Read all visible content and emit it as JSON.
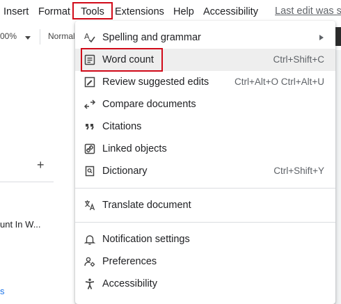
{
  "menubar": {
    "items": [
      "Insert",
      "Format",
      "Tools",
      "Extensions",
      "Help",
      "Accessibility"
    ],
    "last_edit": "Last edit was se"
  },
  "toolbar": {
    "zoom": "00%",
    "style": "Normal"
  },
  "left_panel": {
    "add_symbol": "+",
    "outline_item": "unt In W...",
    "outline_item_2": "s"
  },
  "tools_menu": {
    "items": [
      {
        "label": "Spelling and grammar",
        "icon": "spelling-check-icon",
        "submenu": true
      },
      {
        "label": "Word count",
        "icon": "word-count-icon",
        "shortcut": "Ctrl+Shift+C"
      },
      {
        "label": "Review suggested edits",
        "icon": "review-edits-icon",
        "shortcut": "Ctrl+Alt+O Ctrl+Alt+U"
      },
      {
        "label": "Compare documents",
        "icon": "compare-icon"
      },
      {
        "label": "Citations",
        "icon": "quote-icon"
      },
      {
        "label": "Linked objects",
        "icon": "link-icon"
      },
      {
        "label": "Dictionary",
        "icon": "dictionary-icon",
        "shortcut": "Ctrl+Shift+Y"
      },
      {
        "label": "Translate document",
        "icon": "translate-icon"
      },
      {
        "label": "Notification settings",
        "icon": "bell-icon"
      },
      {
        "label": "Preferences",
        "icon": "preferences-icon"
      },
      {
        "label": "Accessibility",
        "icon": "accessibility-icon"
      }
    ]
  },
  "colors": {
    "highlight_outline": "#d10a19",
    "hover_bg": "#eeeeee",
    "text": "#202124",
    "secondary_text": "#5f6368"
  }
}
